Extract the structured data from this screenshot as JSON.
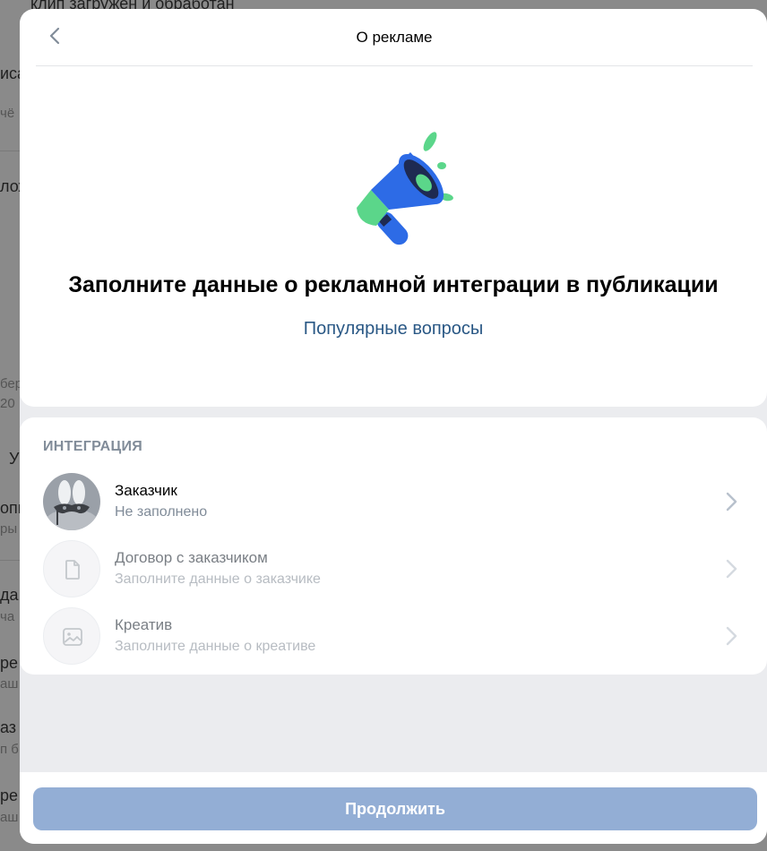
{
  "background": {
    "top_text": "клип загружен и обработан",
    "lines": [
      "иса",
      "чё",
      "лож",
      "бер",
      "20",
      "У",
      "опк",
      "ры",
      "да",
      "ча",
      "ре",
      "аш",
      "аз",
      "п б",
      "ре",
      "аш"
    ]
  },
  "header": {
    "title": "О рекламе"
  },
  "hero": {
    "title": "Заполните данные о рекламной интеграции в публикации",
    "faq_link": "Популярные вопросы"
  },
  "integration": {
    "section_title": "ИНТЕГРАЦИЯ",
    "rows": [
      {
        "title": "Заказчик",
        "subtitle": "Не заполнено"
      },
      {
        "title": "Договор с заказчиком",
        "subtitle": "Заполните данные о заказчике"
      },
      {
        "title": "Креатив",
        "subtitle": "Заполните данные о креативе"
      }
    ]
  },
  "footer": {
    "continue_label": "Продолжить"
  },
  "colors": {
    "link": "#2a5885",
    "button_disabled": "#93aed5",
    "megaphone_blue": "#2d6be6",
    "megaphone_green": "#5bd68a",
    "muted_text": "#818c99"
  }
}
